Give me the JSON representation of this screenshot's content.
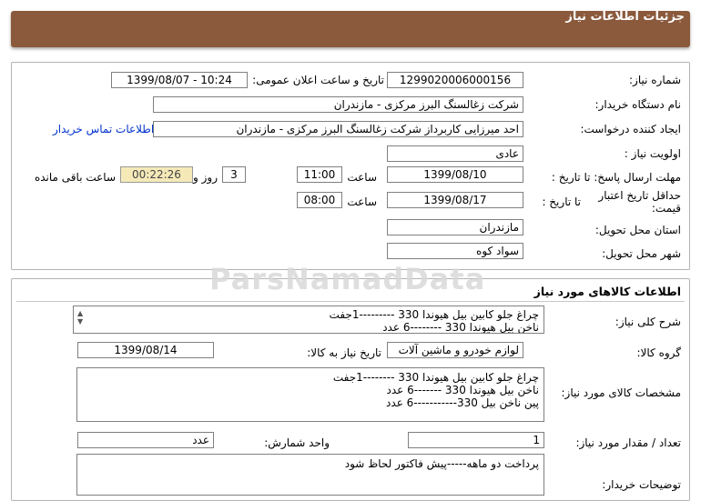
{
  "header": {
    "title": "جزئیات اطلاعات نیاز"
  },
  "info": {
    "need_number_label": "شماره نیاز:",
    "need_number": "1299020006000156",
    "announce_label": "تاریخ و ساعت اعلان عمومی:",
    "announce_value": "1399/08/07 - 10:24",
    "buyer_org_label": "نام دستگاه خریدار:",
    "buyer_org": "شرکت زغالسنگ البرز مرکزی - مازندران",
    "requester_label": "ایجاد کننده درخواست:",
    "requester": "احد میرزایی کاربرداز شرکت زغالسنگ البرز مرکزی - مازندران",
    "contact_link": "اطلاعات تماس خریدار",
    "priority_label": "اولویت نیاز :",
    "priority": "عادی",
    "deadline_label": "مهلت ارسال پاسخ: تا تاریخ :",
    "deadline_date": "1399/08/10",
    "time_label": "ساعت",
    "deadline_time": "11:00",
    "days_value": "3",
    "days_label": "روز و",
    "countdown": "00:22:26",
    "remaining_label": "ساعت باقی مانده",
    "validity_label": "حداقل تاریخ اعتبار قیمت:",
    "validity_to_label": "تا تاریخ :",
    "validity_date": "1399/08/17",
    "validity_time_label": "ساعت",
    "validity_time": "08:00",
    "province_label": "استان محل تحویل:",
    "province": "مازندران",
    "city_label": "شهر محل تحویل:",
    "city": "سواد کوه"
  },
  "goods": {
    "section_title": "اطلاعات کالاهای مورد نیاز",
    "general_desc_label": "شرح کلی نیاز:",
    "general_desc": "چراغ جلو کابین بیل هیوندا 330 ---------1جفت\nناخن بیل هیوندا 330 --------6 عدد",
    "group_label": "گروه کالا:",
    "group": "لوازم خودرو و ماشین آلات",
    "need_date_label": "تاریخ نیاز به کالا:",
    "need_date": "1399/08/14",
    "spec_label": "مشخصات کالای مورد نیاز:",
    "spec": "چراغ جلو کابین بیل هیوندا 330 --------1جفت\nناخن بیل هیوندا 330 -------6 عدد\nپین ناخن بیل 330-----------6 عدد",
    "qty_label": "تعداد / مقدار مورد نیاز:",
    "qty": "1",
    "unit_label": "واحد شمارش:",
    "unit": "عدد",
    "buyer_notes_label": "توضیحات خریدار:",
    "buyer_notes": "پرداخت دو ماهه-----پیش فاکتور لحاظ شود"
  },
  "watermark": {
    "text": "ParsNamadData"
  },
  "colors": {
    "header_bg": "#8b5a3c",
    "countdown_bg": "#f5e9b8",
    "link": "#0033cc"
  }
}
